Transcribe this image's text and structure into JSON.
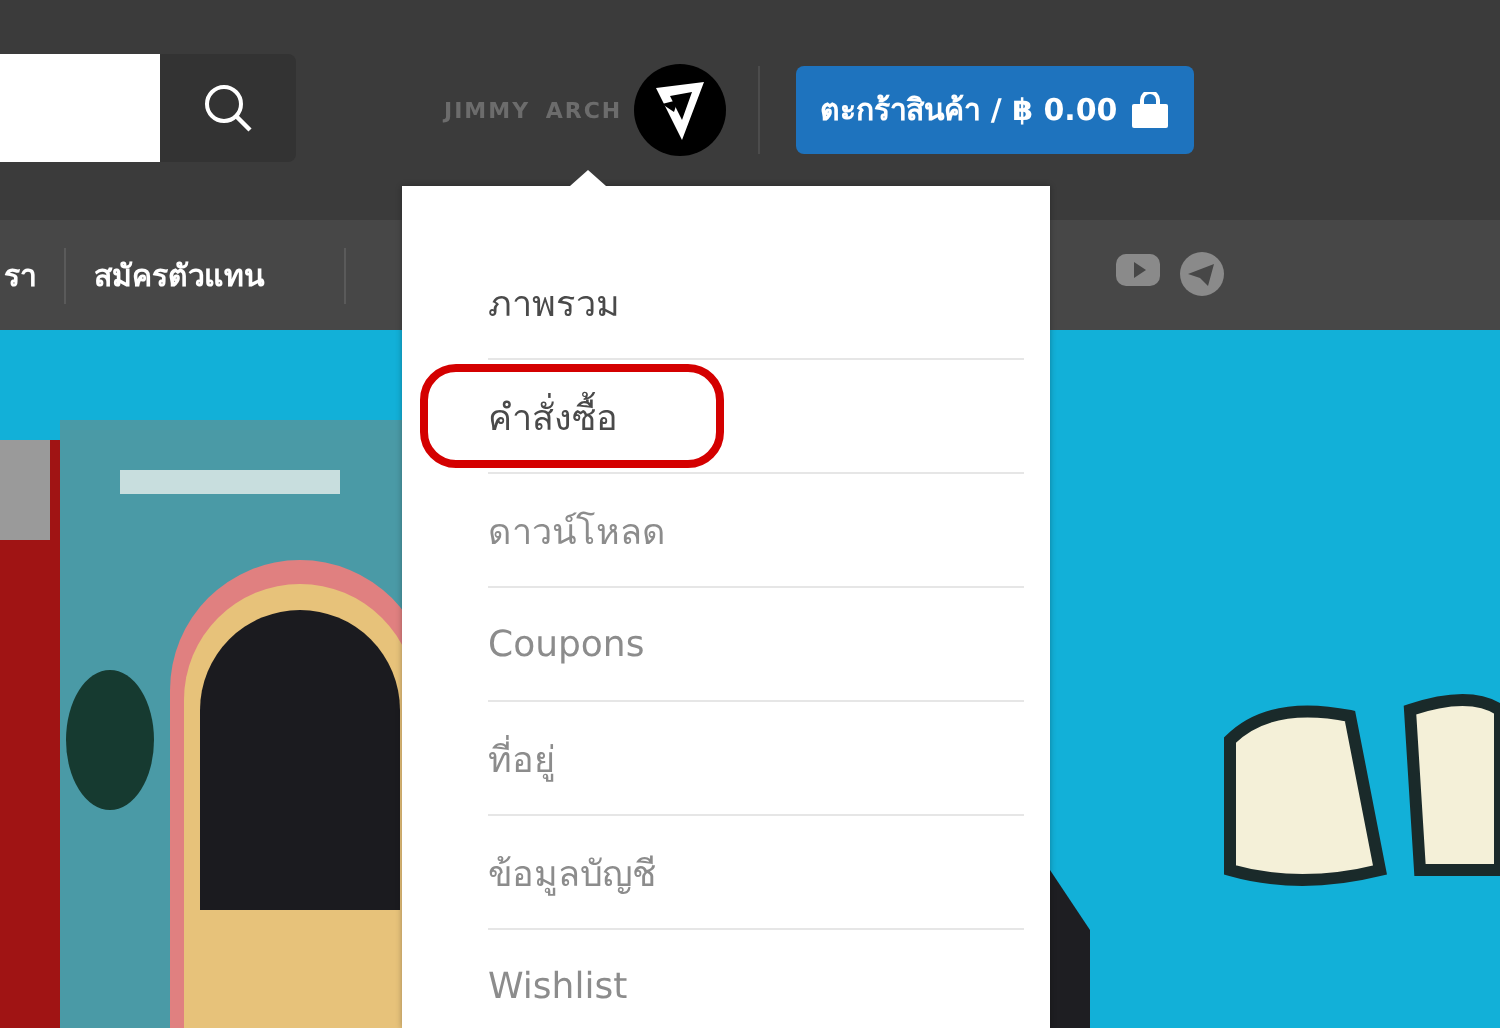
{
  "account": {
    "name": "JIMMY ARCH"
  },
  "cart": {
    "label": "ตะกร้าสินค้า / ฿ 0.00"
  },
  "nav": {
    "items": [
      {
        "label": "รา"
      },
      {
        "label": "สมัครตัวแทน"
      }
    ]
  },
  "menu": {
    "items": [
      {
        "label": "ภาพรวม",
        "dim": false,
        "circled": false
      },
      {
        "label": "คำสั่งซื้อ",
        "dim": false,
        "circled": true
      },
      {
        "label": "ดาวน์โหลด",
        "dim": true,
        "circled": false
      },
      {
        "label": "Coupons",
        "dim": true,
        "circled": false
      },
      {
        "label": "ที่อยู่",
        "dim": true,
        "circled": false
      },
      {
        "label": "ข้อมูลบัญชี",
        "dim": true,
        "circled": false
      },
      {
        "label": "Wishlist",
        "dim": true,
        "circled": false
      }
    ]
  }
}
